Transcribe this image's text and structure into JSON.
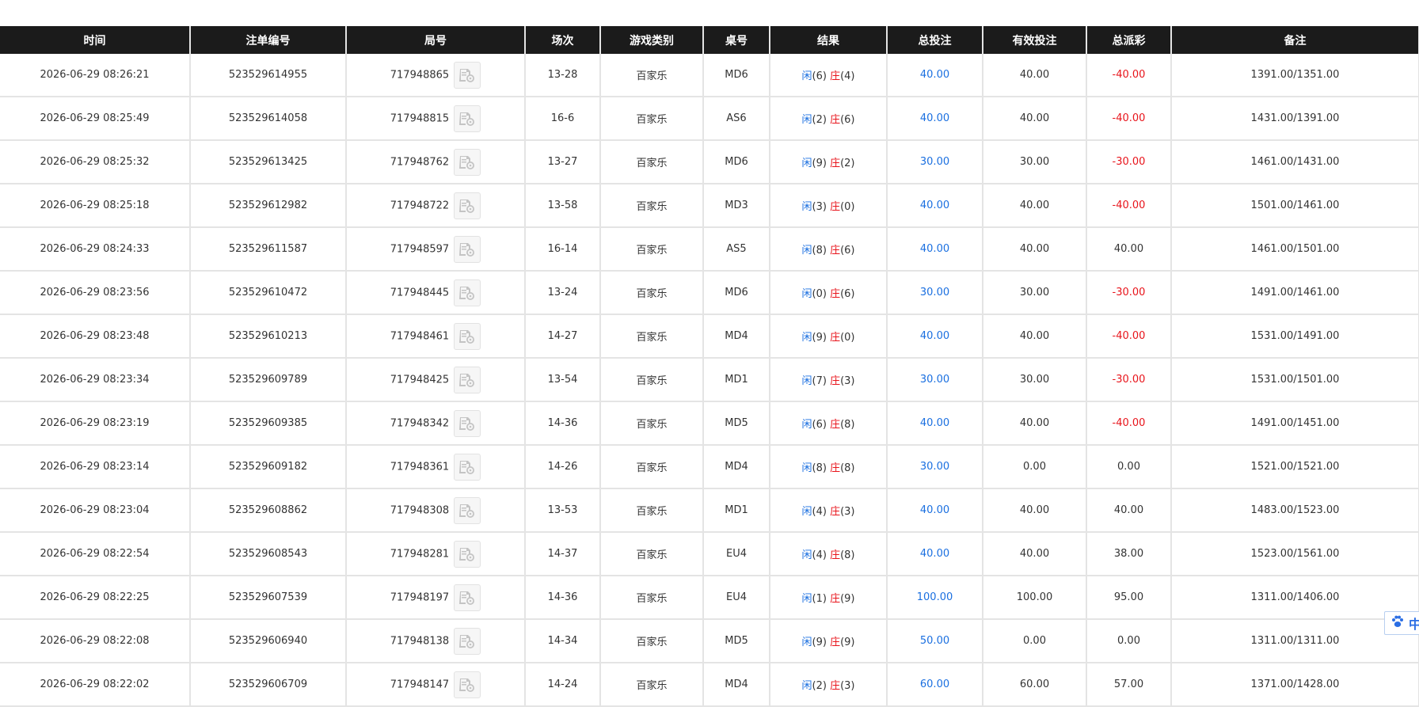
{
  "table": {
    "headers": [
      "时间",
      "注单编号",
      "局号",
      "场次",
      "游戏类别",
      "桌号",
      "结果",
      "总投注",
      "有效投注",
      "总派彩",
      "备注"
    ],
    "rows": [
      {
        "time": "2026-06-29 08:26:21",
        "bet_id": "523529614955",
        "round": "717948865",
        "session": "13-28",
        "game": "百家乐",
        "table": "MD6",
        "player_label": "闲",
        "player_score": "(6)",
        "banker_label": "庄",
        "banker_score": "(4)",
        "total_bet": "40.00",
        "valid_bet": "40.00",
        "payout": "-40.00",
        "payout_color": "red",
        "note": "1391.00/1351.00"
      },
      {
        "time": "2026-06-29 08:25:49",
        "bet_id": "523529614058",
        "round": "717948815",
        "session": "16-6",
        "game": "百家乐",
        "table": "AS6",
        "player_label": "闲",
        "player_score": "(2)",
        "banker_label": "庄",
        "banker_score": "(6)",
        "total_bet": "40.00",
        "valid_bet": "40.00",
        "payout": "-40.00",
        "payout_color": "red",
        "note": "1431.00/1391.00"
      },
      {
        "time": "2026-06-29 08:25:32",
        "bet_id": "523529613425",
        "round": "717948762",
        "session": "13-27",
        "game": "百家乐",
        "table": "MD6",
        "player_label": "闲",
        "player_score": "(9)",
        "banker_label": "庄",
        "banker_score": "(2)",
        "total_bet": "30.00",
        "valid_bet": "30.00",
        "payout": "-30.00",
        "payout_color": "red",
        "note": "1461.00/1431.00"
      },
      {
        "time": "2026-06-29 08:25:18",
        "bet_id": "523529612982",
        "round": "717948722",
        "session": "13-58",
        "game": "百家乐",
        "table": "MD3",
        "player_label": "闲",
        "player_score": "(3)",
        "banker_label": "庄",
        "banker_score": "(0)",
        "total_bet": "40.00",
        "valid_bet": "40.00",
        "payout": "-40.00",
        "payout_color": "red",
        "note": "1501.00/1461.00"
      },
      {
        "time": "2026-06-29 08:24:33",
        "bet_id": "523529611587",
        "round": "717948597",
        "session": "16-14",
        "game": "百家乐",
        "table": "AS5",
        "player_label": "闲",
        "player_score": "(8)",
        "banker_label": "庄",
        "banker_score": "(6)",
        "total_bet": "40.00",
        "valid_bet": "40.00",
        "payout": "40.00",
        "payout_color": "normal",
        "note": "1461.00/1501.00"
      },
      {
        "time": "2026-06-29 08:23:56",
        "bet_id": "523529610472",
        "round": "717948445",
        "session": "13-24",
        "game": "百家乐",
        "table": "MD6",
        "player_label": "闲",
        "player_score": "(0)",
        "banker_label": "庄",
        "banker_score": "(6)",
        "total_bet": "30.00",
        "valid_bet": "30.00",
        "payout": "-30.00",
        "payout_color": "red",
        "note": "1491.00/1461.00"
      },
      {
        "time": "2026-06-29 08:23:48",
        "bet_id": "523529610213",
        "round": "717948461",
        "session": "14-27",
        "game": "百家乐",
        "table": "MD4",
        "player_label": "闲",
        "player_score": "(9)",
        "banker_label": "庄",
        "banker_score": "(0)",
        "total_bet": "40.00",
        "valid_bet": "40.00",
        "payout": "-40.00",
        "payout_color": "red",
        "note": "1531.00/1491.00"
      },
      {
        "time": "2026-06-29 08:23:34",
        "bet_id": "523529609789",
        "round": "717948425",
        "session": "13-54",
        "game": "百家乐",
        "table": "MD1",
        "player_label": "闲",
        "player_score": "(7)",
        "banker_label": "庄",
        "banker_score": "(3)",
        "total_bet": "30.00",
        "valid_bet": "30.00",
        "payout": "-30.00",
        "payout_color": "red",
        "note": "1531.00/1501.00"
      },
      {
        "time": "2026-06-29 08:23:19",
        "bet_id": "523529609385",
        "round": "717948342",
        "session": "14-36",
        "game": "百家乐",
        "table": "MD5",
        "player_label": "闲",
        "player_score": "(6)",
        "banker_label": "庄",
        "banker_score": "(8)",
        "total_bet": "40.00",
        "valid_bet": "40.00",
        "payout": "-40.00",
        "payout_color": "red",
        "note": "1491.00/1451.00"
      },
      {
        "time": "2026-06-29 08:23:14",
        "bet_id": "523529609182",
        "round": "717948361",
        "session": "14-26",
        "game": "百家乐",
        "table": "MD4",
        "player_label": "闲",
        "player_score": "(8)",
        "banker_label": "庄",
        "banker_score": "(8)",
        "total_bet": "30.00",
        "valid_bet": "0.00",
        "payout": "0.00",
        "payout_color": "normal",
        "note": "1521.00/1521.00"
      },
      {
        "time": "2026-06-29 08:23:04",
        "bet_id": "523529608862",
        "round": "717948308",
        "session": "13-53",
        "game": "百家乐",
        "table": "MD1",
        "player_label": "闲",
        "player_score": "(4)",
        "banker_label": "庄",
        "banker_score": "(3)",
        "total_bet": "40.00",
        "valid_bet": "40.00",
        "payout": "40.00",
        "payout_color": "normal",
        "note": "1483.00/1523.00"
      },
      {
        "time": "2026-06-29 08:22:54",
        "bet_id": "523529608543",
        "round": "717948281",
        "session": "14-37",
        "game": "百家乐",
        "table": "EU4",
        "player_label": "闲",
        "player_score": "(4)",
        "banker_label": "庄",
        "banker_score": "(8)",
        "total_bet": "40.00",
        "valid_bet": "40.00",
        "payout": "38.00",
        "payout_color": "normal",
        "note": "1523.00/1561.00"
      },
      {
        "time": "2026-06-29 08:22:25",
        "bet_id": "523529607539",
        "round": "717948197",
        "session": "14-36",
        "game": "百家乐",
        "table": "EU4",
        "player_label": "闲",
        "player_score": "(1)",
        "banker_label": "庄",
        "banker_score": "(9)",
        "total_bet": "100.00",
        "valid_bet": "100.00",
        "payout": "95.00",
        "payout_color": "normal",
        "note": "1311.00/1406.00"
      },
      {
        "time": "2026-06-29 08:22:08",
        "bet_id": "523529606940",
        "round": "717948138",
        "session": "14-34",
        "game": "百家乐",
        "table": "MD5",
        "player_label": "闲",
        "player_score": "(9)",
        "banker_label": "庄",
        "banker_score": "(9)",
        "total_bet": "50.00",
        "valid_bet": "0.00",
        "payout": "0.00",
        "payout_color": "normal",
        "note": "1311.00/1311.00"
      },
      {
        "time": "2026-06-29 08:22:02",
        "bet_id": "523529606709",
        "round": "717948147",
        "session": "14-24",
        "game": "百家乐",
        "table": "MD4",
        "player_label": "闲",
        "player_score": "(2)",
        "banker_label": "庄",
        "banker_score": "(3)",
        "total_bet": "60.00",
        "valid_bet": "60.00",
        "payout": "57.00",
        "payout_color": "normal",
        "note": "1371.00/1428.00"
      }
    ]
  },
  "side_widget": {
    "label": "中",
    "icon": "paw-icon"
  },
  "colors": {
    "header_bg": "#1b1b1b",
    "blue": "#1a6fe0",
    "red": "#e8141b",
    "border": "#e4e4e4"
  }
}
